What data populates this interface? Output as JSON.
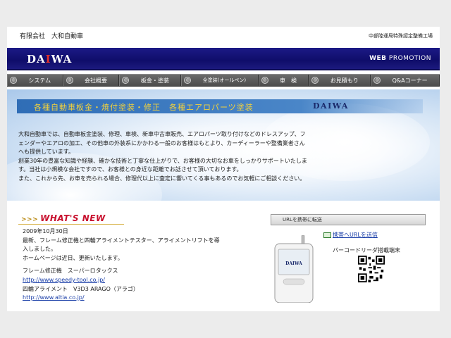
{
  "header": {
    "company": "有限会社　大和自動車",
    "certified": "中部陸運局特殊認定整備工場"
  },
  "brand": {
    "logo_left": "DA",
    "logo_x": "I",
    "logo_right": "WA",
    "web": "WEB",
    "promotion": "PROMOTION"
  },
  "nav": [
    {
      "label": "システム",
      "icon": "circle-icon"
    },
    {
      "label": "会社概要",
      "icon": "circle-icon"
    },
    {
      "label": "板金・塗装",
      "icon": "circle-icon"
    },
    {
      "label": "全塗装(オールペン)",
      "icon": "circle-icon"
    },
    {
      "label": "車　検",
      "icon": "circle-icon"
    },
    {
      "label": "お見積もり",
      "icon": "circle-icon"
    },
    {
      "label": "Q&Aコーナー",
      "icon": "circle-icon"
    }
  ],
  "hero": {
    "banner": "各種自動車板金・焼付塗装・修正　各種エアロパーツ塗装",
    "banner_logo": "DAIWA",
    "intro": [
      "大和自動車では、自動車板金塗装、修理、車検、新車中古車販売、エアロパーツ取り付けなどのドレスアップ、フ",
      "ェンダーやエアロの加工、その他車の外装系にかかわる一般のお客様はもとより、カーディーラーや整備業者さん",
      "へも提供しています。",
      "創業30年の豊富な知識や経験、確かな技術と丁寧な仕上がりで、お客様の大切なお車をしっかりサポートいたしま",
      "す。当社は小規模な会社ですので、お客様との身近な距離でお話させて頂いております。",
      "また、これから先、お車を売られる場合、修理代以上に査定に響いてくる事もあるのでお気軽にご相談ください。"
    ]
  },
  "whatsnew": {
    "title": "WHAT'S NEW",
    "date": "2009年10月30日",
    "lines": [
      "最新、フレーム修正機と四輪アライメントテスター、アライメントリフトを導",
      "入しました。",
      "ホームページは近日、更新いたします。"
    ],
    "item1_label": "フレーム修正機　スーパーロタックス",
    "item1_link": "http://www.speedy-tool.co.jp/",
    "item2_label": "四輪アライメント　V3D3 ARAGO（アラゴ）",
    "item2_link": "http://www.altia.co.jp/"
  },
  "mobile": {
    "url_transfer": "URLを携帯に転送",
    "send_link": "携帯へURLを送信",
    "barcode_label": "バーコードリーダ搭載端末",
    "phone_brand": "DAIWA"
  },
  "colors": {
    "brand_blue": "#141283",
    "logo_red": "#e2312b",
    "banner_yellow": "#f4d23b",
    "whatsnew_red": "#c8102e",
    "link_blue": "#1b3fa8"
  }
}
